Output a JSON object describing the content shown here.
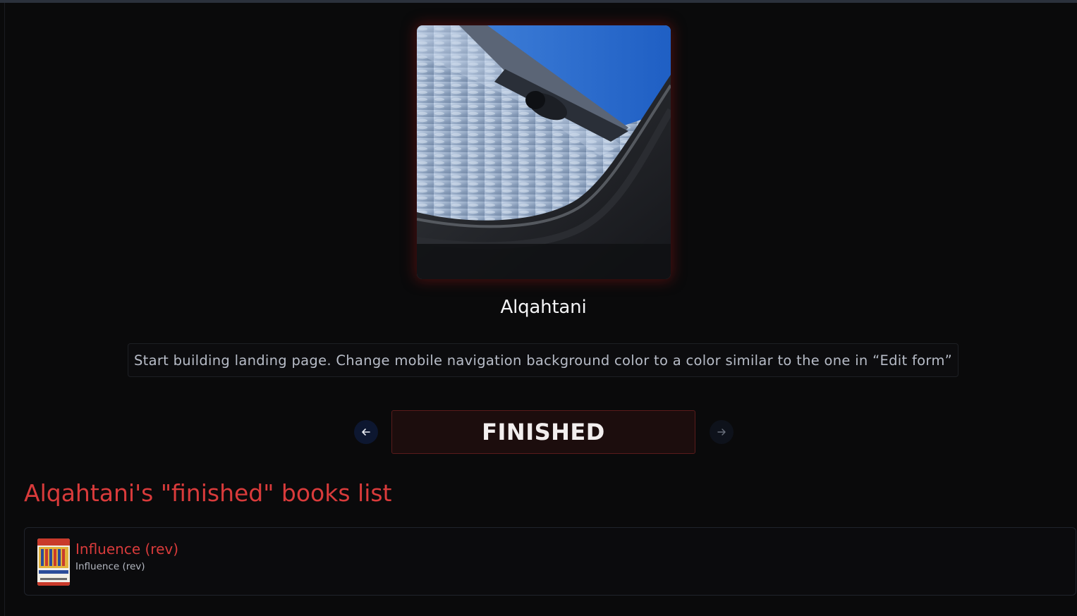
{
  "profile": {
    "avatar_alt": "Airplane window view of wing and engine above clouds",
    "username": "Alqahtani",
    "status_text": "Start building landing page. Change mobile navigation background color to a color similar to the one in “Edit form”"
  },
  "shelf_switcher": {
    "prev_icon": "arrow-left-icon",
    "next_icon": "arrow-right-icon",
    "current_shelf": "FINISHED"
  },
  "books_section": {
    "title": "Alqahtani's \"finished\" books list",
    "books": [
      {
        "title": "Influence (rev)",
        "subtitle": "Influence (rev)",
        "cover_icon": "book-cover-influence"
      }
    ]
  },
  "colors": {
    "background": "#0a0a0b",
    "accent_red": "#d93b3b",
    "shelf_box_bg": "#1c0d0d",
    "shelf_box_border": "#5a1b1b"
  }
}
